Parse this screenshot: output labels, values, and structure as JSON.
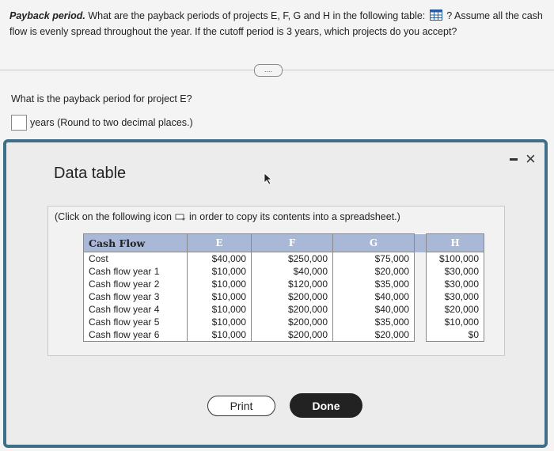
{
  "question": {
    "label": "Payback period.",
    "text_before_icon": "What are the payback periods of projects E, F, G and H in the following table:",
    "text_after_icon": "? Assume all the cash flow is evenly spread throughout the year. If the cutoff period is 3 years, which projects do you accept?"
  },
  "expand_button": "....",
  "subquestion": "What is the payback period for project E?",
  "answer": {
    "value": "",
    "unit": "years",
    "hint": "(Round to two decimal places.)"
  },
  "dialog": {
    "title": "Data table",
    "minimize_label": "-",
    "close_label": "×",
    "note_before": "(Click on the following icon",
    "note_after": "in order to copy its contents into a spreadsheet.)",
    "print_label": "Print",
    "done_label": "Done"
  },
  "table": {
    "headers": [
      "Cash Flow",
      "E",
      "F",
      "G",
      "H"
    ],
    "rows": [
      [
        "Cost",
        "$40,000",
        "$250,000",
        "$75,000",
        "$100,000"
      ],
      [
        "Cash flow year 1",
        "$10,000",
        "$40,000",
        "$20,000",
        "$30,000"
      ],
      [
        "Cash flow year 2",
        "$10,000",
        "$120,000",
        "$35,000",
        "$30,000"
      ],
      [
        "Cash flow year 3",
        "$10,000",
        "$200,000",
        "$40,000",
        "$30,000"
      ],
      [
        "Cash flow year 4",
        "$10,000",
        "$200,000",
        "$40,000",
        "$20,000"
      ],
      [
        "Cash flow year 5",
        "$10,000",
        "$200,000",
        "$35,000",
        "$10,000"
      ],
      [
        "Cash flow year 6",
        "$10,000",
        "$200,000",
        "$20,000",
        "$0"
      ]
    ]
  },
  "colors": {
    "dialog_border": "#3e6e88",
    "table_header": "#a9b8d6",
    "done_button": "#222222"
  }
}
